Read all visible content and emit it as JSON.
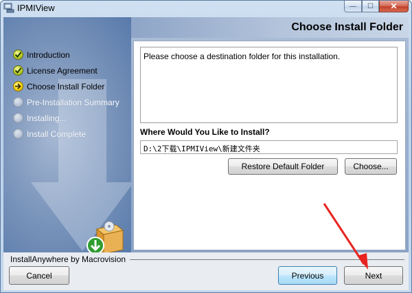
{
  "window": {
    "title": "IPMIView",
    "minimize_glyph": "—",
    "maximize_glyph": "☐",
    "close_glyph": "✕"
  },
  "header": {
    "title": "Choose Install Folder"
  },
  "steps": [
    {
      "label": "Introduction",
      "state": "done"
    },
    {
      "label": "License Agreement",
      "state": "done"
    },
    {
      "label": "Choose Install Folder",
      "state": "current"
    },
    {
      "label": "Pre-Installation Summary",
      "state": "pending"
    },
    {
      "label": "Installing...",
      "state": "pending"
    },
    {
      "label": "Install Complete",
      "state": "pending"
    }
  ],
  "main": {
    "message": "Please choose a destination folder for this installation.",
    "question": "Where Would You Like to Install?",
    "install_path": "D:\\2下载\\IPMIView\\新建文件夹",
    "restore_label": "Restore Default Folder",
    "choose_label": "Choose..."
  },
  "footer": {
    "vendor": "InstallAnywhere by Macrovision",
    "cancel_label": "Cancel",
    "previous_label": "Previous",
    "next_label": "Next"
  },
  "colors": {
    "annotation_arrow": "#e8231f",
    "panel_border": "#98a8bf",
    "header_band": "#b7c7dd"
  }
}
